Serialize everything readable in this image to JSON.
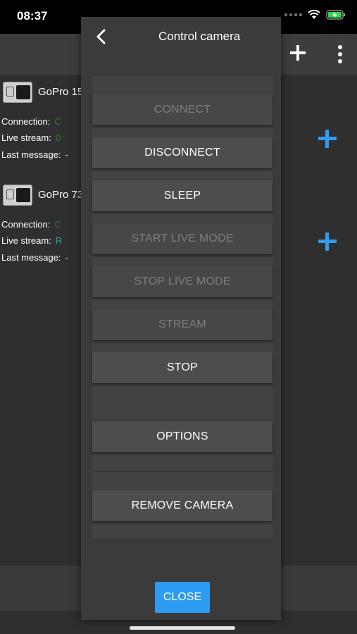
{
  "status_bar": {
    "time": "08:37"
  },
  "cameras": [
    {
      "name": "GoPro 15",
      "connection_label": "Connection:",
      "connection_value": "C",
      "stream_label": "Live stream:",
      "stream_value": "0",
      "message_label": "Last message:",
      "message_value": "-"
    },
    {
      "name": "GoPro 73",
      "connection_label": "Connection:",
      "connection_value": "C",
      "stream_label": "Live stream:",
      "stream_value": "R",
      "message_label": "Last message:",
      "message_value": "-"
    }
  ],
  "modal": {
    "title": "Control camera",
    "buttons": {
      "connect": "CONNECT",
      "disconnect": "DISCONNECT",
      "sleep": "SLEEP",
      "start_live_mode": "START LIVE MODE",
      "stop_live_mode": "STOP LIVE MODE",
      "stream": "STREAM",
      "stop": "STOP",
      "options": "OPTIONS",
      "remove_camera": "REMOVE CAMERA"
    },
    "close_label": "CLOSE"
  },
  "colors": {
    "accent": "#2c9cf2",
    "status_green": "#2e7d32",
    "status_teal": "#26a69a"
  }
}
